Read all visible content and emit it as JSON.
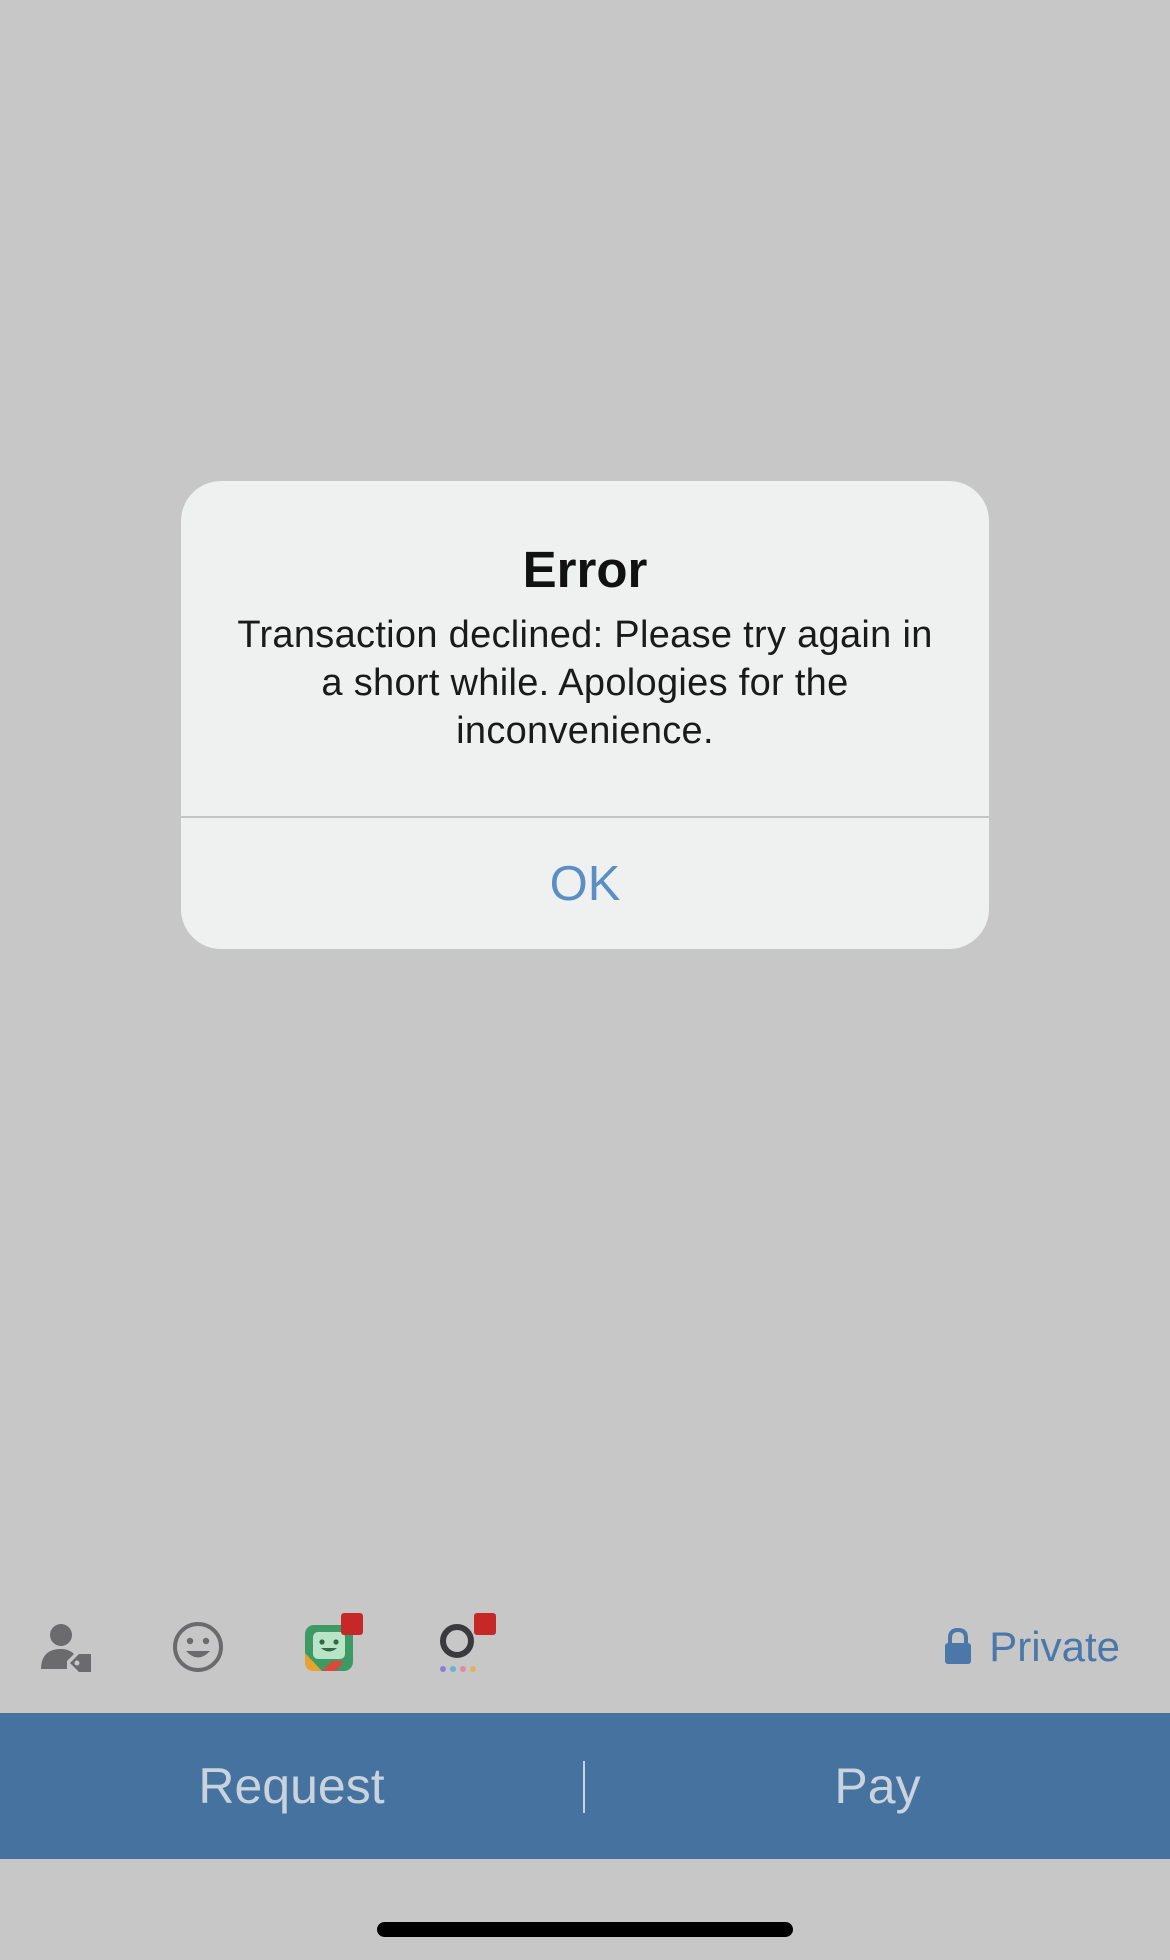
{
  "alert": {
    "title": "Error",
    "message": "Transaction declined: Please try again in a short while. Apologies for the inconvenience.",
    "ok_label": "OK"
  },
  "toolbar": {
    "icons": [
      "person-tag-icon",
      "smiley-icon",
      "sticker-icon",
      "gif-icon"
    ],
    "privacy_label": "Private",
    "privacy_icon": "lock-icon"
  },
  "actions": {
    "request_label": "Request",
    "pay_label": "Pay"
  },
  "colors": {
    "accent": "#45729f",
    "alert_button": "#5b8fc3",
    "badge": "#c62828",
    "background": "#c7c7c8"
  }
}
